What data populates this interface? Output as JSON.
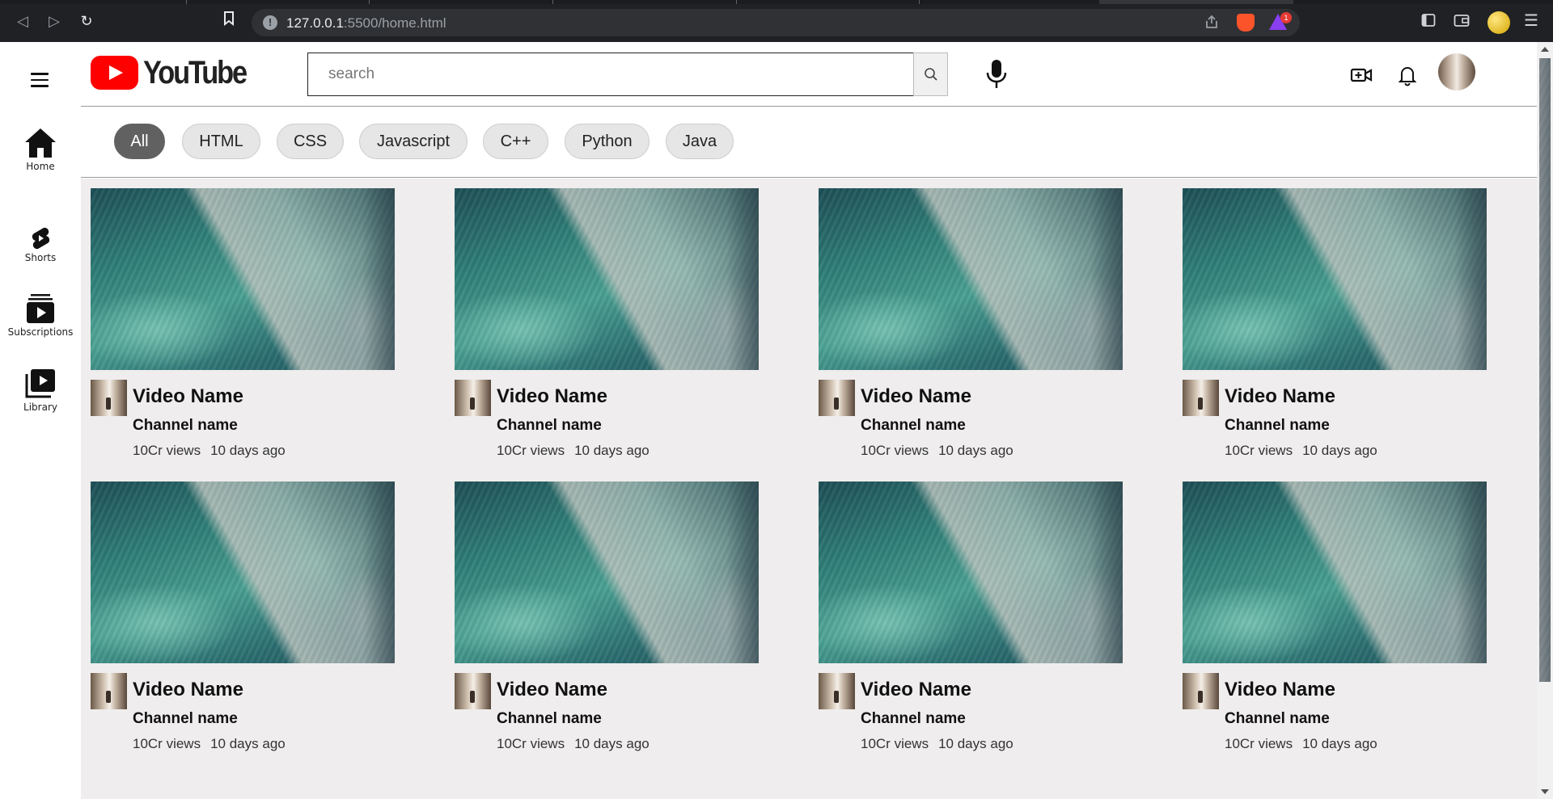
{
  "browser": {
    "url_host": "127.0.0.1",
    "url_rest": ":5500/home.html",
    "notification_badge": "1"
  },
  "header": {
    "logo_text": "YouTube",
    "search": {
      "placeholder": "search",
      "value": ""
    }
  },
  "sidebar": {
    "items": [
      {
        "label": "Home",
        "icon": "home-icon"
      },
      {
        "label": "Shorts",
        "icon": "shorts-icon"
      },
      {
        "label": "Subscriptions",
        "icon": "subscriptions-icon"
      },
      {
        "label": "Library",
        "icon": "library-icon"
      }
    ]
  },
  "chips": [
    "All",
    "HTML",
    "CSS",
    "Javascript",
    "C++",
    "Python",
    "Java"
  ],
  "active_chip": "All",
  "videos": [
    {
      "title": "Video Name",
      "channel": "Channel name",
      "views": "10Cr views",
      "age": "10 days ago"
    },
    {
      "title": "Video Name",
      "channel": "Channel name",
      "views": "10Cr views",
      "age": "10 days ago"
    },
    {
      "title": "Video Name",
      "channel": "Channel name",
      "views": "10Cr views",
      "age": "10 days ago"
    },
    {
      "title": "Video Name",
      "channel": "Channel name",
      "views": "10Cr views",
      "age": "10 days ago"
    },
    {
      "title": "Video Name",
      "channel": "Channel name",
      "views": "10Cr views",
      "age": "10 days ago"
    },
    {
      "title": "Video Name",
      "channel": "Channel name",
      "views": "10Cr views",
      "age": "10 days ago"
    },
    {
      "title": "Video Name",
      "channel": "Channel name",
      "views": "10Cr views",
      "age": "10 days ago"
    },
    {
      "title": "Video Name",
      "channel": "Channel name",
      "views": "10Cr views",
      "age": "10 days ago"
    }
  ],
  "colors": {
    "brand_red": "#ff0000",
    "active_chip_bg": "#616161",
    "chip_bg": "#e6e6e6",
    "content_bg": "#efeded"
  }
}
